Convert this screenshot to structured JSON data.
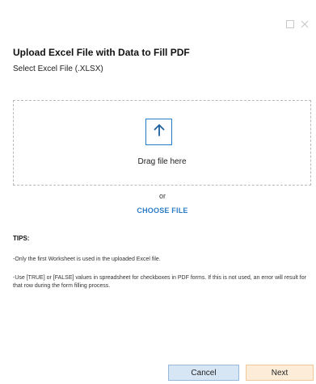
{
  "dialog": {
    "title": "Upload Excel File with Data to Fill PDF",
    "subtitle": "Select Excel File (.XLSX)"
  },
  "window_controls": {
    "maximize_icon": "square-icon",
    "close_icon": "close-icon"
  },
  "dropzone": {
    "icon": "arrow-up-icon",
    "label": "Drag file here"
  },
  "or_label": "or",
  "choose_file_label": "CHOOSE FILE",
  "tips": {
    "heading": "TIPS:",
    "items": [
      "-Only the first Worksheet is used in the uploaded Excel file.",
      "-Use [TRUE] or [FALSE] values in spreadsheet for checkboxes in PDF forms.  If this is not used, an error will result for that row during the form filling process."
    ]
  },
  "buttons": {
    "cancel": "Cancel",
    "next": "Next"
  },
  "colors": {
    "accent": "#2b7cc6",
    "cancel_bg": "#d6e6f5",
    "next_bg": "#fdecd8"
  }
}
